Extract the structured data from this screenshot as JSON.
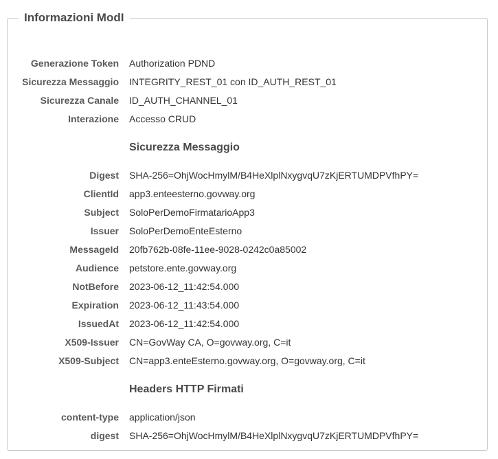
{
  "panel": {
    "title": "Informazioni ModI"
  },
  "general": [
    {
      "label": "Generazione Token",
      "value": "Authorization PDND"
    },
    {
      "label": "Sicurezza Messaggio",
      "value": "INTEGRITY_REST_01 con ID_AUTH_REST_01"
    },
    {
      "label": "Sicurezza Canale",
      "value": "ID_AUTH_CHANNEL_01"
    },
    {
      "label": "Interazione",
      "value": "Accesso CRUD"
    }
  ],
  "security": {
    "title": "Sicurezza Messaggio",
    "rows": [
      {
        "label": "Digest",
        "value": "SHA-256=OhjWocHmylM/B4HeXlplNxygvqU7zKjERTUMDPVfhPY="
      },
      {
        "label": "ClientId",
        "value": "app3.enteesterno.govway.org"
      },
      {
        "label": "Subject",
        "value": "SoloPerDemoFirmatarioApp3"
      },
      {
        "label": "Issuer",
        "value": "SoloPerDemoEnteEsterno"
      },
      {
        "label": "MessageId",
        "value": "20fb762b-08fe-11ee-9028-0242c0a85002"
      },
      {
        "label": "Audience",
        "value": "petstore.ente.govway.org"
      },
      {
        "label": "NotBefore",
        "value": "2023-06-12_11:42:54.000"
      },
      {
        "label": "Expiration",
        "value": "2023-06-12_11:43:54.000"
      },
      {
        "label": "IssuedAt",
        "value": "2023-06-12_11:42:54.000"
      },
      {
        "label": "X509-Issuer",
        "value": "CN=GovWay CA, O=govway.org, C=it"
      },
      {
        "label": "X509-Subject",
        "value": "CN=app3.enteEsterno.govway.org, O=govway.org, C=it"
      }
    ]
  },
  "headers": {
    "title": "Headers HTTP Firmati",
    "rows": [
      {
        "label": "content-type",
        "value": "application/json"
      },
      {
        "label": "digest",
        "value": "SHA-256=OhjWocHmylM/B4HeXlplNxygvqU7zKjERTUMDPVfhPY="
      }
    ]
  }
}
